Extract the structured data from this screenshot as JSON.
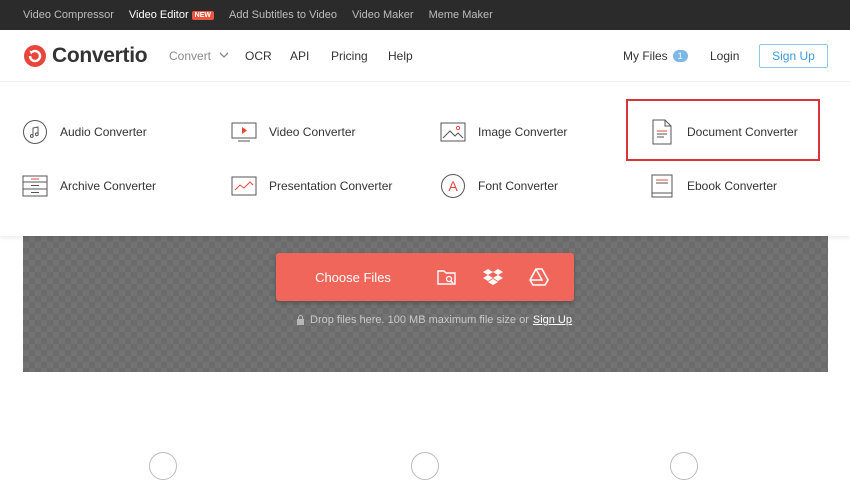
{
  "topbar": {
    "links": [
      {
        "label": "Video Compressor"
      },
      {
        "label": "Video Editor",
        "badge": "NEW"
      },
      {
        "label": "Add Subtitles to Video"
      },
      {
        "label": "Video Maker"
      },
      {
        "label": "Meme Maker"
      }
    ]
  },
  "header": {
    "logo": "Convertio",
    "nav": {
      "convert": "Convert",
      "ocr": "OCR",
      "api": "API",
      "pricing": "Pricing",
      "help": "Help"
    },
    "my_files": "My Files",
    "my_files_count": "1",
    "login": "Login",
    "signup": "Sign Up"
  },
  "converters": {
    "row1": [
      {
        "label": "Audio Converter",
        "icon": "music-note-icon"
      },
      {
        "label": "Video Converter",
        "icon": "video-play-icon"
      },
      {
        "label": "Image Converter",
        "icon": "image-icon"
      },
      {
        "label": "Document Converter",
        "icon": "document-icon"
      }
    ],
    "row2": [
      {
        "label": "Archive Converter",
        "icon": "archive-icon"
      },
      {
        "label": "Presentation Converter",
        "icon": "presentation-icon"
      },
      {
        "label": "Font Converter",
        "icon": "font-icon",
        "glyph": "A"
      },
      {
        "label": "Ebook Converter",
        "icon": "ebook-icon"
      }
    ]
  },
  "upload": {
    "choose_files": "Choose Files",
    "drop_note": "Drop files here. 100 MB maximum file size or",
    "signup_link": "Sign Up"
  },
  "colors": {
    "accent": "#f0665a",
    "brand_red": "#e8463b",
    "highlight": "#d8343a",
    "link_blue": "#3c9ad8"
  }
}
